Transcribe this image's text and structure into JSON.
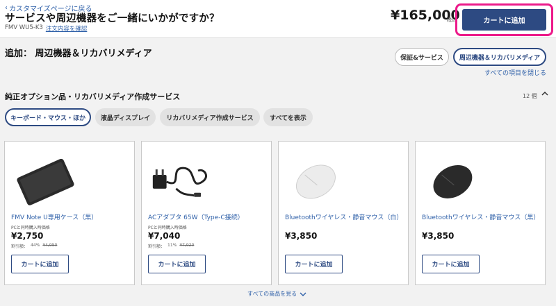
{
  "header": {
    "back_label": "カスタマイズページに戻る",
    "title": "サービスや周辺機器をご一緒にいかがですか？",
    "model": "FMV WU5-K3",
    "confirm_label": "注文内容を確認",
    "price": "¥165,000",
    "tax": "税込",
    "cart_label": "カートに追加"
  },
  "section": {
    "heading": "追加：  周辺機器＆リカバリメディア",
    "pills": [
      "保証&サービス",
      "周辺機器＆リカバリメディア"
    ],
    "close_all": "すべての項目を閉じる"
  },
  "category": {
    "title": "純正オプション品・リカバリメディア作成サービス",
    "count": "12 個",
    "filters": [
      "キーボード・マウス・ほか",
      "液晶ディスプレイ",
      "リカバリメディア作成サービス",
      "すべてを表示"
    ]
  },
  "products": [
    {
      "name": "FMV Note U専用ケース（黒）",
      "sub": "PCと同時購入時価格",
      "price": "¥2,750",
      "disc_label": "割引額：",
      "disc_pct": "44%",
      "orig": "¥4,950",
      "btn": "カートに追加"
    },
    {
      "name": "ACアダプタ 65W（Type-C接続）",
      "sub": "PCと同時購入時価格",
      "price": "¥7,040",
      "disc_label": "割引額：",
      "disc_pct": "11%",
      "orig": "¥7,920",
      "btn": "カートに追加"
    },
    {
      "name": "Bluetoothワイヤレス・静音マウス（白）",
      "sub": "",
      "price": "¥3,850",
      "btn": "カートに追加"
    },
    {
      "name": "Bluetoothワイヤレス・静音マウス（黒）",
      "sub": "",
      "price": "¥3,850",
      "btn": "カートに追加"
    }
  ],
  "see_all": "すべての商品を見る",
  "colors": {
    "accent": "#2d4a82",
    "highlight": "#ec1a8a",
    "link": "#2d5fa8"
  }
}
